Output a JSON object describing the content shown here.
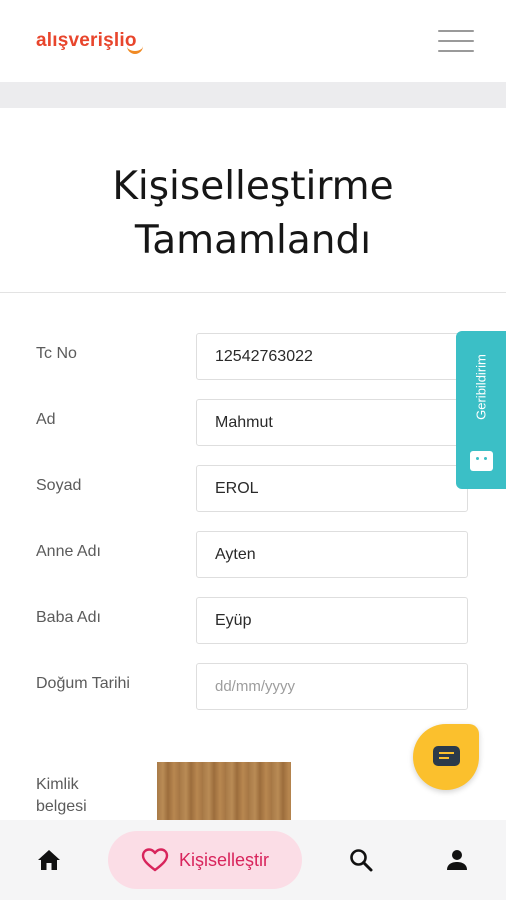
{
  "header": {
    "logo_text": "alışverişlio",
    "menu_icon": "hamburger-menu-icon"
  },
  "page": {
    "title_line1": "Kişiselleştirme",
    "title_line2": "Tamamlandı"
  },
  "form": {
    "fields": [
      {
        "label": "Tc No",
        "value": "12542763022",
        "placeholder": ""
      },
      {
        "label": "Ad",
        "value": "Mahmut",
        "placeholder": ""
      },
      {
        "label": "Soyad",
        "value": "EROL",
        "placeholder": ""
      },
      {
        "label": "Anne Adı",
        "value": "Ayten",
        "placeholder": ""
      },
      {
        "label": "Baba Adı",
        "value": "Eyüp",
        "placeholder": ""
      },
      {
        "label": "Doğum Tarihi",
        "value": "",
        "placeholder": "dd/mm/yyyy"
      }
    ],
    "document_label": "Kimlik belgesi"
  },
  "feedback": {
    "label": "Geribildirim",
    "color": "#3bbfc6"
  },
  "chat": {
    "icon": "chat-icon",
    "color": "#fbc02d"
  },
  "bottom_nav": {
    "home_icon": "home-icon",
    "personalize_label": "Kişiselleştir",
    "personalize_icon": "heart-icon",
    "search_icon": "search-icon",
    "profile_icon": "user-icon",
    "accent_color": "#d8245c"
  }
}
